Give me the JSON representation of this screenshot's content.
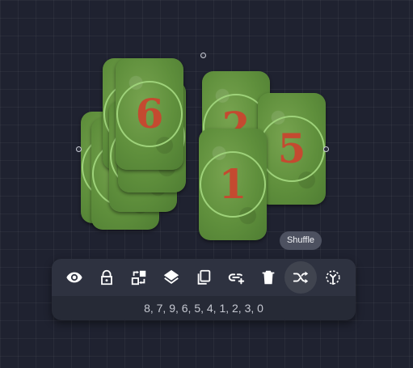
{
  "canvas": {
    "cards": [
      {
        "id": "back-1",
        "label": ""
      },
      {
        "id": "back-2",
        "label": ""
      },
      {
        "id": "back-3",
        "label": ""
      },
      {
        "id": "back-4",
        "label": ""
      },
      {
        "id": "back-5",
        "label": ""
      },
      {
        "id": "card-6",
        "label": "6"
      },
      {
        "id": "card-2",
        "label": "2"
      },
      {
        "id": "card-5",
        "label": "5"
      },
      {
        "id": "card-1",
        "label": "1"
      }
    ]
  },
  "tooltip": {
    "label": "Shuffle"
  },
  "toolbar": {
    "buttons": [
      {
        "name": "visibility",
        "icon": "eye-icon"
      },
      {
        "name": "lock",
        "icon": "lock-icon"
      },
      {
        "name": "swap",
        "icon": "swap-icon"
      },
      {
        "name": "layers",
        "icon": "layers-icon"
      },
      {
        "name": "duplicate",
        "icon": "copy-icon"
      },
      {
        "name": "link",
        "icon": "link-add-icon"
      },
      {
        "name": "delete",
        "icon": "trash-icon"
      },
      {
        "name": "shuffle",
        "icon": "shuffle-icon",
        "active": true
      },
      {
        "name": "spread",
        "icon": "spread-icon"
      }
    ],
    "order_text": "8, 7, 9, 6, 5, 4, 1, 2, 3, 0"
  },
  "colors": {
    "background": "#1f2230",
    "card_green": "#5f8f3c",
    "card_number": "#c44a30",
    "ring": "#9ed27a",
    "toolbar": "#2e3240"
  }
}
